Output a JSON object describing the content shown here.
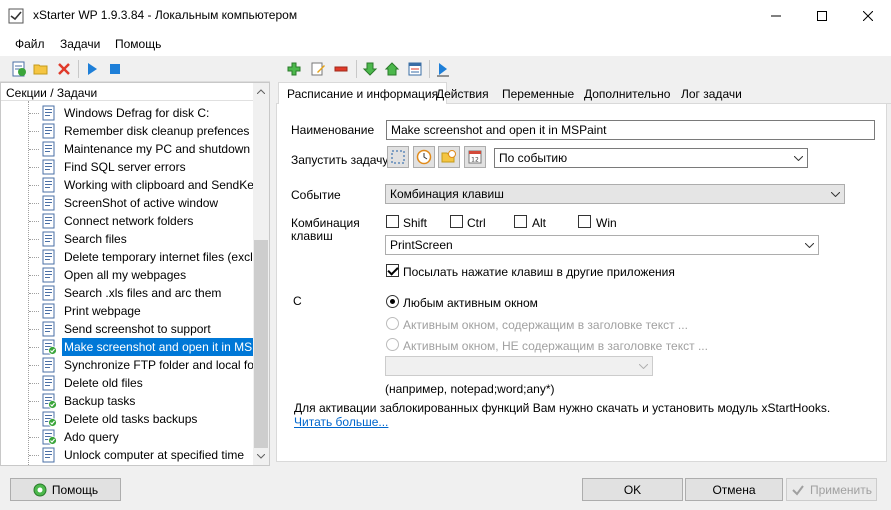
{
  "window": {
    "title": "xStarter WP 1.9.3.84 - Локальным компьютером"
  },
  "menu": [
    "Файл",
    "Задачи",
    "Помощь"
  ],
  "left": {
    "header": "Секции / Задачи",
    "tasks": [
      {
        "label": "Windows Defrag for disk C:",
        "icon": "task-icon"
      },
      {
        "label": "Remember disk cleanup prefences (r...",
        "icon": "task-icon"
      },
      {
        "label": "Maintenance my PC and shutdown",
        "icon": "task-icon"
      },
      {
        "label": "Find SQL server errors",
        "icon": "task-icon"
      },
      {
        "label": "Working with clipboard and SendKey",
        "icon": "task-icon"
      },
      {
        "label": "ScreenShot of active window",
        "icon": "task-icon"
      },
      {
        "label": "Connect network folders",
        "icon": "task-icon"
      },
      {
        "label": "Search files",
        "icon": "task-icon"
      },
      {
        "label": "Delete temporary internet files (excl...",
        "icon": "task-icon"
      },
      {
        "label": "Open all my webpages",
        "icon": "task-icon"
      },
      {
        "label": "Search .xls files and arc them",
        "icon": "task-icon"
      },
      {
        "label": "Print webpage",
        "icon": "task-icon"
      },
      {
        "label": "Send screenshot to support",
        "icon": "task-icon"
      },
      {
        "label": "Make screenshot and open it in MSP...",
        "icon": "task-active-icon"
      },
      {
        "label": "Synchronize FTP folder and local folder",
        "icon": "task-icon"
      },
      {
        "label": "Delete old files",
        "icon": "task-icon"
      },
      {
        "label": "Backup tasks",
        "icon": "task-active-icon"
      },
      {
        "label": "Delete old tasks backups",
        "icon": "task-active-icon"
      },
      {
        "label": "Ado query",
        "icon": "task-active-icon"
      },
      {
        "label": "Unlock computer at specified time",
        "icon": "task-icon"
      }
    ]
  },
  "tabs": [
    "Расписание и информация",
    "Действия",
    "Переменные",
    "Дополнительно",
    "Лог задачи"
  ],
  "form": {
    "name_label": "Наименование",
    "name_value": "Make screenshot and open it in MSPaint",
    "run_label": "Запустить задачу",
    "run_mode": "По событию",
    "event_label": "Событие",
    "event_value": "Комбинация клавиш",
    "combo_label_1": "Комбинация",
    "combo_label_2": "клавиш",
    "mods": [
      "Shift",
      "Ctrl",
      "Alt",
      "Win"
    ],
    "key_value": "PrintScreen",
    "send_keys_label": "Посылать нажатие клавиш в другие приложения",
    "with_label": "С",
    "radio_any": "Любым активным окном",
    "radio_contains": "Активным окном, содержащим в заголовке текст ...",
    "radio_not_contains": "Активным окном, НЕ содержащим в заголовке текст ...",
    "example": "(например, notepad;word;any*)",
    "note": "Для активации заблокированных функций Вам нужно скачать и установить модуль xStartHooks.",
    "more_link": "Читать больше..."
  },
  "buttons": {
    "help": "Помощь",
    "ok": "OK",
    "cancel": "Отмена",
    "apply": "Применить"
  }
}
